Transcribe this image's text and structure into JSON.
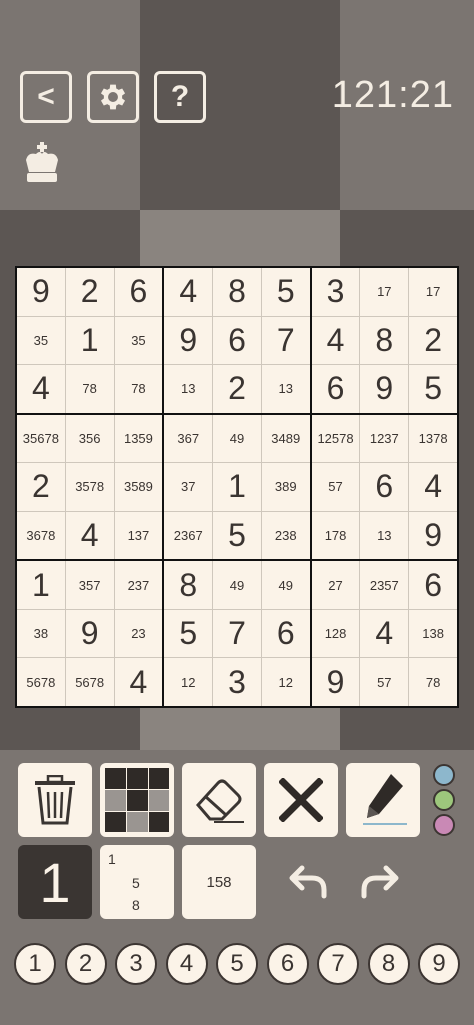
{
  "header": {
    "back_label": "<",
    "help_label": "?",
    "timer": "121:21"
  },
  "board": {
    "rows": [
      [
        "9",
        "2",
        "6",
        "4",
        "8",
        "5",
        "3",
        "17",
        "17"
      ],
      [
        "35",
        "1",
        "35",
        "9",
        "6",
        "7",
        "4",
        "8",
        "2"
      ],
      [
        "4",
        "78",
        "78",
        "13",
        "2",
        "13",
        "6",
        "9",
        "5"
      ],
      [
        "35678",
        "356",
        "1359",
        "367",
        "49",
        "3489",
        "12578",
        "1237",
        "1378"
      ],
      [
        "2",
        "3578",
        "3589",
        "37",
        "1",
        "389",
        "57",
        "6",
        "4"
      ],
      [
        "3678",
        "4",
        "137",
        "2367",
        "5",
        "238",
        "178",
        "13",
        "9"
      ],
      [
        "1",
        "357",
        "237",
        "8",
        "49",
        "49",
        "27",
        "2357",
        "6"
      ],
      [
        "38",
        "9",
        "23",
        "5",
        "7",
        "6",
        "128",
        "4",
        "138"
      ],
      [
        "5678",
        "5678",
        "4",
        "12",
        "3",
        "12",
        "9",
        "57",
        "78"
      ]
    ]
  },
  "tools": {
    "colors": [
      "#8db7cc",
      "#9dc77c",
      "#c989b5"
    ]
  },
  "entry": {
    "selected_digit": "1",
    "note_digits": [
      "1",
      "5",
      "8"
    ],
    "note_combo": "158"
  },
  "numpad": [
    "1",
    "2",
    "3",
    "4",
    "5",
    "6",
    "7",
    "8",
    "9"
  ]
}
